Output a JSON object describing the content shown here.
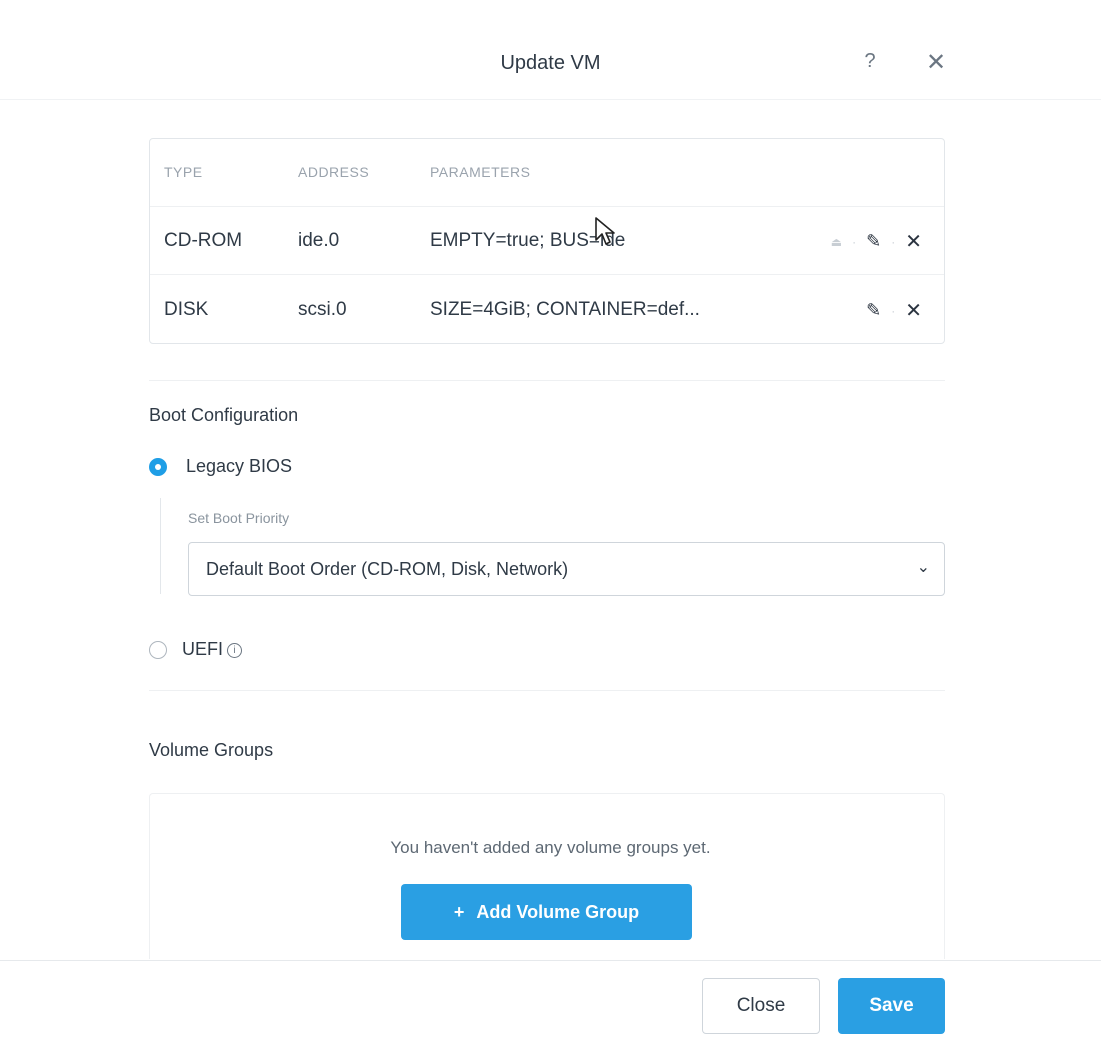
{
  "dialog": {
    "title": "Update VM",
    "help_symbol": "?",
    "close_symbol": "✕"
  },
  "disks": {
    "headers": [
      "TYPE",
      "ADDRESS",
      "PARAMETERS"
    ],
    "rows": [
      {
        "type": "CD-ROM",
        "address": "ide.0",
        "parameters": "EMPTY=true; BUS=ide",
        "actions": [
          "eject",
          "edit",
          "remove"
        ]
      },
      {
        "type": "DISK",
        "address": "scsi.0",
        "parameters": "SIZE=4GiB; CONTAINER=def...",
        "actions": [
          "edit",
          "remove"
        ]
      }
    ]
  },
  "boot": {
    "section_title": "Boot Configuration",
    "options": [
      {
        "label": "Legacy BIOS",
        "selected": true
      },
      {
        "label": "UEFI",
        "selected": false
      }
    ],
    "priority_label": "Set Boot Priority",
    "priority_value": "Default Boot Order (CD-ROM, Disk, Network)"
  },
  "volume_groups": {
    "section_title": "Volume Groups",
    "empty_message": "You haven't added any volume groups yet.",
    "add_button_label": "Add Volume Group",
    "add_button_icon": "+"
  },
  "footer": {
    "close_label": "Close",
    "save_label": "Save"
  },
  "colors": {
    "accent": "#2a9fe3",
    "text": "#2f3a46",
    "muted": "#9aa3ad"
  }
}
